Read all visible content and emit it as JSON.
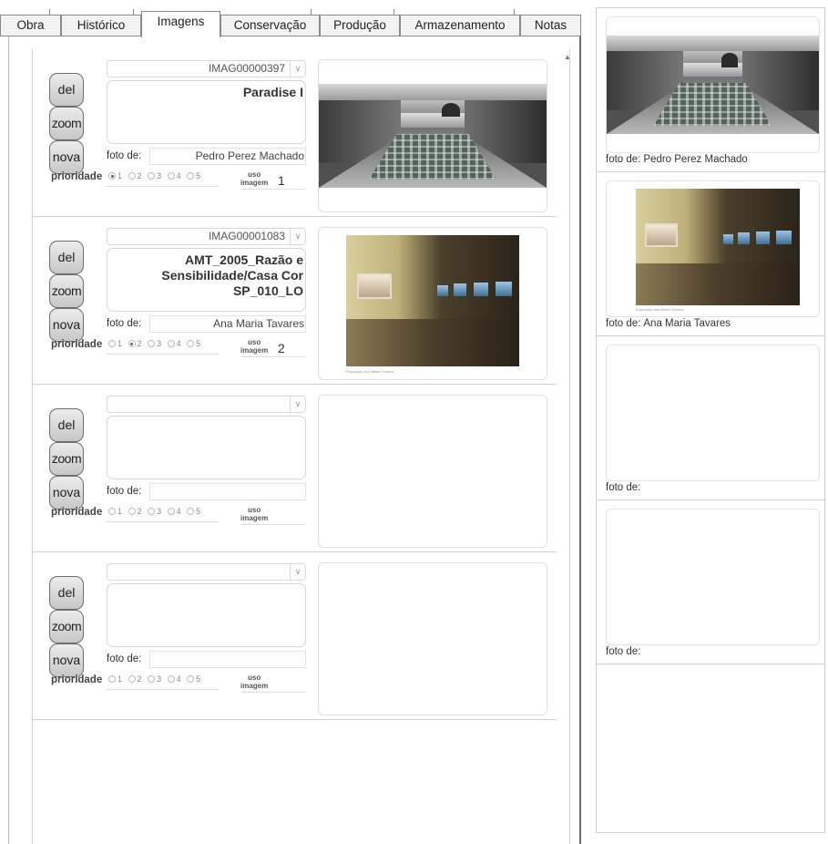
{
  "tabs": [
    {
      "label": "Obra"
    },
    {
      "label": "Histórico"
    },
    {
      "label": "Imagens"
    },
    {
      "label": "Conservação"
    },
    {
      "label": "Produção"
    },
    {
      "label": "Armazenamento"
    },
    {
      "label": "Notas"
    }
  ],
  "active_tab": "Imagens",
  "buttons": {
    "del": "del",
    "zoom": "zoom",
    "nova": "nova"
  },
  "labels": {
    "foto_de": "foto de:",
    "prioridade": "prioridade",
    "uso_line1": "uso",
    "uso_line2": "imagem",
    "priority_options": [
      "1",
      "2",
      "3",
      "4",
      "5"
    ]
  },
  "images": [
    {
      "code": "IMAG00000397",
      "title": "Paradise I",
      "photographer": "Pedro Perez Machado",
      "priority": "1",
      "uso": "1",
      "has_image": true,
      "picture": "room-installation"
    },
    {
      "code": "IMAG00001083",
      "title": "AMT_2005_Razão e Sensibilidade/Casa Cor SP_010_LO",
      "photographer": "Ana Maria Tavares",
      "priority": "2",
      "uso": "2",
      "has_image": true,
      "picture": "gallery-screens",
      "caption": "Exposição Ana Maria Tavares"
    },
    {
      "code": "",
      "title": "",
      "photographer": "",
      "priority": "",
      "uso": "",
      "has_image": false
    },
    {
      "code": "",
      "title": "",
      "photographer": "",
      "priority": "",
      "uso": "",
      "has_image": false
    }
  ],
  "preview": [
    {
      "label": "foto de:",
      "photographer": "Pedro Perez Machado",
      "has_image": true,
      "picture": "room-installation"
    },
    {
      "label": "foto de:",
      "photographer": "Ana Maria Tavares",
      "has_image": true,
      "picture": "gallery-screens",
      "caption": "Exposição Ana Maria Tavares"
    },
    {
      "label": "foto de:",
      "photographer": "",
      "has_image": false
    },
    {
      "label": "foto de:",
      "photographer": "",
      "has_image": false
    }
  ]
}
